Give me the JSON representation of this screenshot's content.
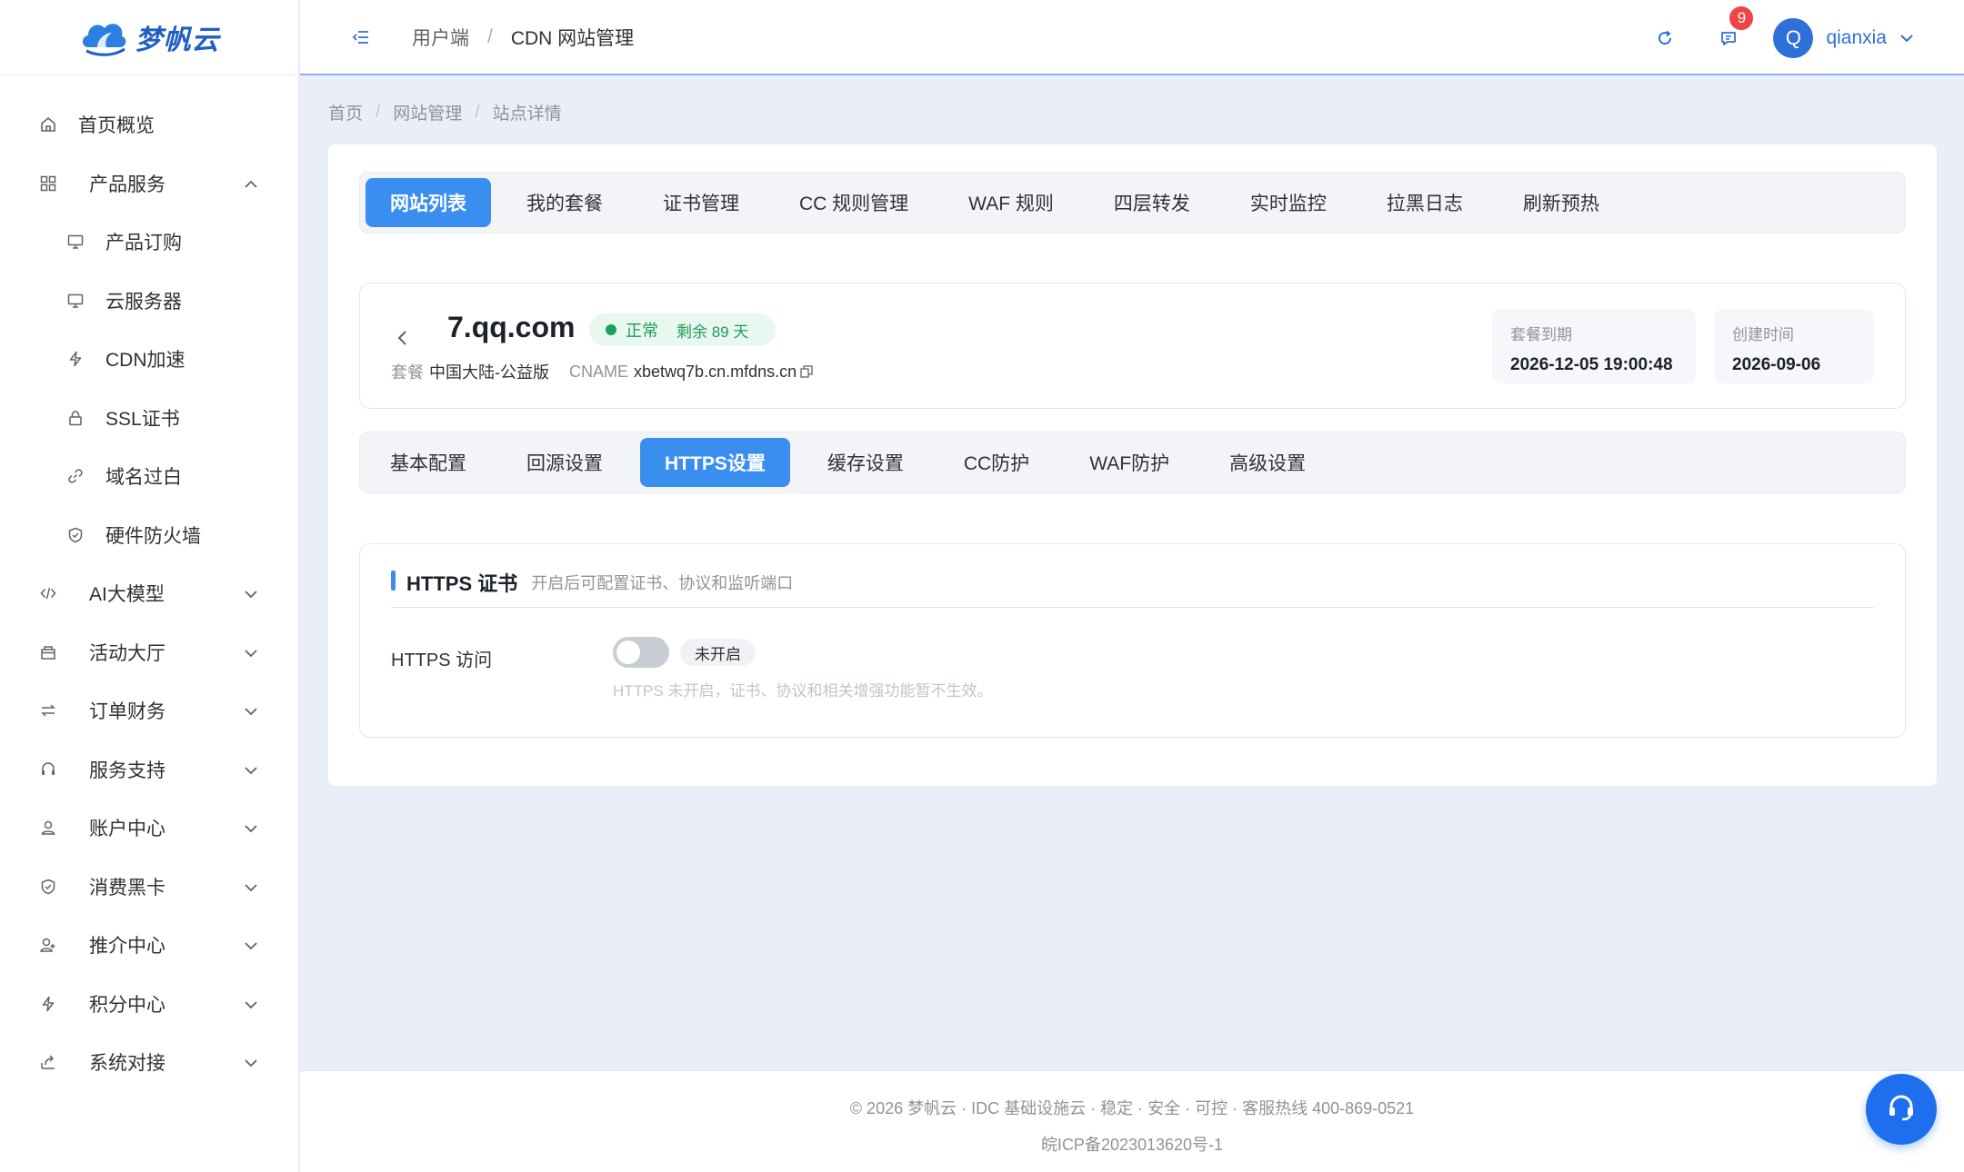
{
  "brand": {
    "name": "梦帆云",
    "color": "#1f5fc4"
  },
  "sidebar": {
    "items": [
      {
        "label": "首页概览",
        "icon": "home-icon",
        "type": "top"
      },
      {
        "label": "产品服务",
        "icon": "grid-icon",
        "type": "group-open"
      },
      {
        "label": "产品订购",
        "icon": "monitor-icon",
        "type": "sub"
      },
      {
        "label": "云服务器",
        "icon": "monitor-icon",
        "type": "sub"
      },
      {
        "label": "CDN加速",
        "icon": "bolt-icon",
        "type": "sub"
      },
      {
        "label": "SSL证书",
        "icon": "lock-icon",
        "type": "sub"
      },
      {
        "label": "域名过白",
        "icon": "link-icon",
        "type": "sub"
      },
      {
        "label": "硬件防火墙",
        "icon": "shield-icon",
        "type": "sub"
      },
      {
        "label": "AI大模型",
        "icon": "code-icon",
        "type": "group"
      },
      {
        "label": "活动大厅",
        "icon": "gift-icon",
        "type": "group"
      },
      {
        "label": "订单财务",
        "icon": "swap-icon",
        "type": "group"
      },
      {
        "label": "服务支持",
        "icon": "headset-icon",
        "type": "group"
      },
      {
        "label": "账户中心",
        "icon": "user-icon",
        "type": "group"
      },
      {
        "label": "消费黑卡",
        "icon": "shield-check-icon",
        "type": "group"
      },
      {
        "label": "推介中心",
        "icon": "user-plus-icon",
        "type": "group"
      },
      {
        "label": "积分中心",
        "icon": "bolt-icon",
        "type": "group"
      },
      {
        "label": "系统对接",
        "icon": "share-icon",
        "type": "group"
      }
    ]
  },
  "header": {
    "breadcrumb": [
      "用户端",
      "CDN 网站管理"
    ],
    "notification_count": "9",
    "avatar_letter": "Q",
    "username": "qianxia",
    "accent": "#2f6fd8"
  },
  "content_breadcrumb": [
    "首页",
    "网站管理",
    "站点详情"
  ],
  "top_tabs": [
    "网站列表",
    "我的套餐",
    "证书管理",
    "CC 规则管理",
    "WAF 规则",
    "四层转发",
    "实时监控",
    "拉黑日志",
    "刷新预热"
  ],
  "top_tabs_active": 0,
  "site": {
    "domain": "7.qq.com",
    "status": "正常",
    "remaining": "剩余 89 天",
    "plan_label": "套餐",
    "plan_value": "中国大陆-公益版",
    "cname_label": "CNAME",
    "cname_value": "xbetwq7b.cn.mfdns.cn",
    "expire_label": "套餐到期",
    "expire_value": "2026-12-05 19:00:48",
    "created_label": "创建时间",
    "created_value": "2026-09-06"
  },
  "sub_tabs": [
    "基本配置",
    "回源设置",
    "HTTPS设置",
    "缓存设置",
    "CC防护",
    "WAF防护",
    "高级设置"
  ],
  "sub_tabs_active": 2,
  "https": {
    "title": "HTTPS 证书",
    "desc": "开启后可配置证书、协议和监听端口",
    "row_label": "HTTPS 访问",
    "switch_on": false,
    "switch_text": "未开启",
    "hint": "HTTPS 未开启，证书、协议和相关增强功能暂不生效。"
  },
  "footer": {
    "line1": "© 2026 梦帆云 · IDC 基础设施云 · 稳定 · 安全 · 可控 · 客服热线 400-869-0521",
    "line2": "皖ICP备2023013620号-1"
  },
  "colors": {
    "primary": "#3a8ef0",
    "success": "#1e9e57",
    "danger": "#f04545",
    "fab": "#1e6ff0"
  }
}
